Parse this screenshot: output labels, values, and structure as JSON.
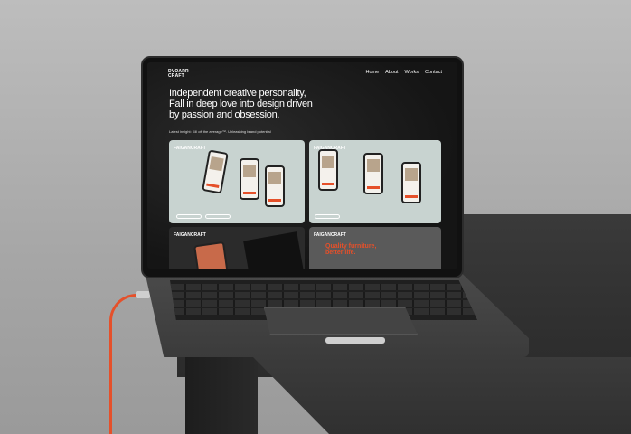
{
  "site": {
    "logo_line1": "DVOARR",
    "logo_line2": "CRAFT",
    "nav": [
      "Home",
      "About",
      "Works",
      "Contact"
    ],
    "hero_heading": "Independent creative personality, Fall in deep love into design driven by passion and obsession.",
    "tagline": "Latest insight: Kill off the average™. Unleashing brand potential",
    "cards": [
      {
        "label": "FAIGANCRAFT"
      },
      {
        "label": "FAIGANCRAFT"
      },
      {
        "label": "FAIGANCRAFT"
      },
      {
        "label": "FAIGANCRAFT",
        "headline": "Quality furniture, better life."
      }
    ],
    "phone_headline": "Quality furniture, better life."
  },
  "colors": {
    "accent": "#e5502a",
    "screen_bg": "#151515",
    "card_bg": "#c8d3d0"
  }
}
